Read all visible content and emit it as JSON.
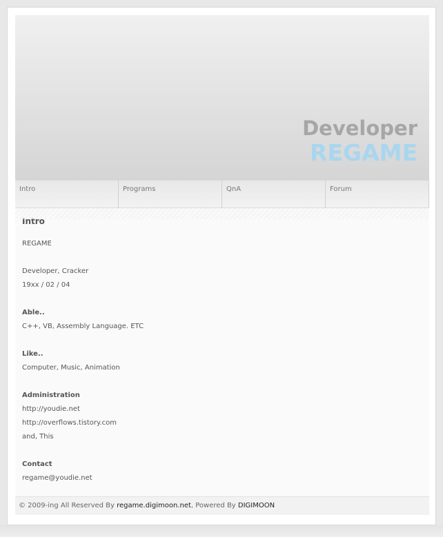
{
  "header": {
    "brand_top": "Developer",
    "brand_bottom": "REGAME"
  },
  "nav": {
    "items": [
      {
        "label": "Intro"
      },
      {
        "label": "Programs"
      },
      {
        "label": "QnA"
      },
      {
        "label": "Forum"
      }
    ]
  },
  "content": {
    "title": "Intro",
    "name": "REGAME",
    "role": "Developer, Cracker",
    "birth": "19xx / 02 / 04",
    "able_head": "Able..",
    "able_text": "C++, VB, Assembly Language. ETC",
    "like_head": "Like..",
    "like_text": "Computer, Music, Animation",
    "admin_head": "Administration",
    "admin_links": [
      "http://youdie.net",
      "http://overflows.tistory.com",
      "and, This"
    ],
    "contact_head": "Contact",
    "contact_email": "regame@youdie.net"
  },
  "footer": {
    "prefix": "© 2009-ing All Reserved By ",
    "site_link": "regame.digimoon.net",
    "middle": ", Powered By ",
    "powered_link": "DIGIMOON"
  },
  "colors": {
    "brand_top": "#a6a6a6",
    "brand_bottom": "#a9d6ef"
  }
}
